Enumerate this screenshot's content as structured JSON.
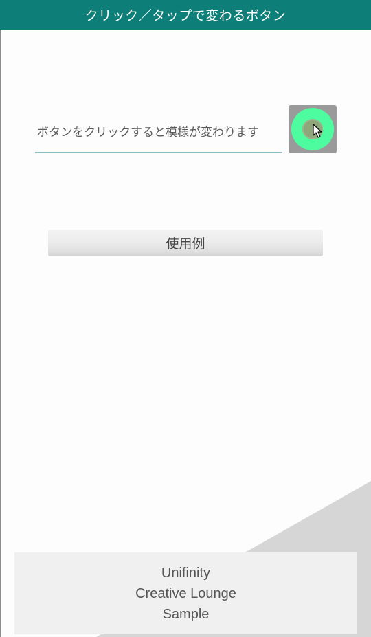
{
  "header": {
    "title": "クリック／タップで変わるボタン"
  },
  "main": {
    "hint_text": "ボタンをクリックすると模様が変わります",
    "example_button_label": "使用例",
    "pattern_button_icon": "ring-pattern-icon"
  },
  "footer": {
    "line1": "Unifinity",
    "line2": "Creative Lounge",
    "line3": "Sample"
  },
  "colors": {
    "header_bg": "#0e7f78",
    "accent_ring": "#4efca0",
    "underline": "#86bfbd"
  }
}
